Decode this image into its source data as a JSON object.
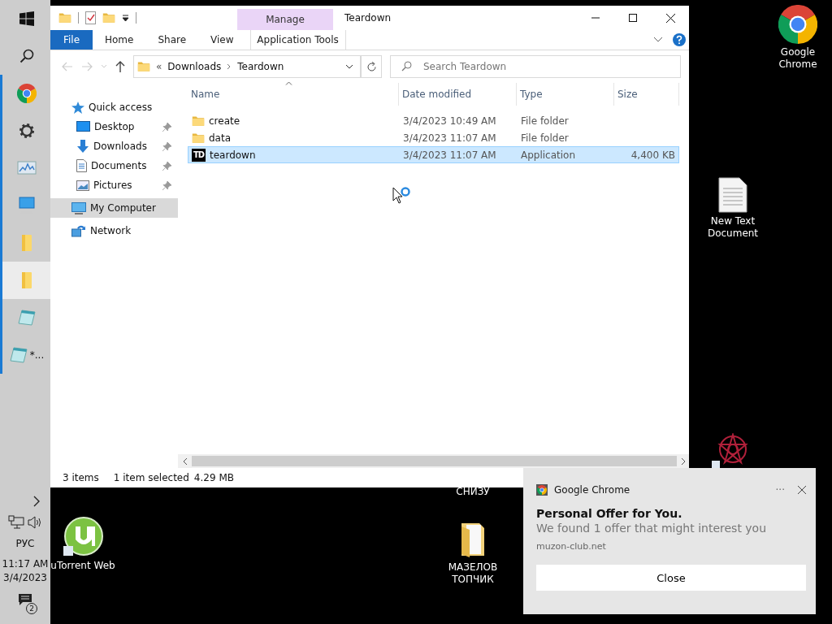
{
  "taskbar": {
    "apps": [
      {
        "kind": "start",
        "active": false
      },
      {
        "kind": "search",
        "active": false
      },
      {
        "kind": "chrome",
        "active": false
      },
      {
        "kind": "settings",
        "active": false
      },
      {
        "kind": "monitor",
        "active": false
      },
      {
        "kind": "computer",
        "active": false
      },
      {
        "kind": "folder",
        "active": false
      },
      {
        "kind": "folder",
        "active": true
      },
      {
        "kind": "notepad",
        "active": false
      },
      {
        "kind": "notepad",
        "active": false,
        "label": "*..."
      }
    ],
    "language": "РУС",
    "time": "11:17 AM",
    "date": "3/4/2023",
    "notification_count": "2"
  },
  "explorer": {
    "title": "Teardown",
    "context_tab": "Manage",
    "ribbon_tabs": [
      {
        "label": "File",
        "kind": "file",
        "selected": false
      },
      {
        "label": "Home",
        "kind": "tab",
        "selected": false
      },
      {
        "label": "Share",
        "kind": "tab",
        "selected": false
      },
      {
        "label": "View",
        "kind": "tab",
        "selected": false
      },
      {
        "label": "Application Tools",
        "kind": "context",
        "selected": false
      }
    ],
    "breadcrumb": {
      "overflow": "«",
      "parts": [
        "Downloads",
        "Teardown"
      ]
    },
    "search": {
      "placeholder": "Search Teardown"
    },
    "nav": [
      {
        "label": "Quick access",
        "kind": "quick",
        "pinned": false,
        "selected": false,
        "children": [
          {
            "label": "Desktop",
            "kind": "desktop",
            "pinned": true,
            "selected": false
          },
          {
            "label": "Downloads",
            "kind": "downloads",
            "pinned": true,
            "selected": false
          },
          {
            "label": "Documents",
            "kind": "documents",
            "pinned": true,
            "selected": false
          },
          {
            "label": "Pictures",
            "kind": "pictures",
            "pinned": true,
            "selected": false
          }
        ]
      },
      {
        "label": "My Computer",
        "kind": "computer",
        "pinned": false,
        "selected": true
      },
      {
        "label": "Network",
        "kind": "network",
        "pinned": false,
        "selected": false
      }
    ],
    "columns": [
      "Name",
      "Date modified",
      "Type",
      "Size"
    ],
    "rows": [
      {
        "name": "create",
        "kind": "folder",
        "date": "3/4/2023 10:49 AM",
        "type": "File folder",
        "selected": false
      },
      {
        "name": "data",
        "kind": "folder",
        "date": "3/4/2023 11:07 AM",
        "type": "File folder",
        "selected": false
      },
      {
        "name": "teardown",
        "kind": "application",
        "icon_text": "TD",
        "date": "3/4/2023 11:07 AM",
        "type": "Application",
        "size": "4,400 KB",
        "selected": true
      }
    ],
    "status": {
      "items": "3 items",
      "selection": "1 item selected",
      "size": "4.29 MB"
    }
  },
  "desktop_icons": [
    {
      "kind": "chrome",
      "label": "Google Chrome"
    },
    {
      "kind": "text-document",
      "label": "New Text Document"
    },
    {
      "kind": "mandala"
    },
    {
      "kind": "utorrent",
      "label": "uTorrent Web"
    },
    {
      "kind": "caption",
      "label": "СНИЗУ"
    },
    {
      "kind": "folder",
      "label": "МАЗЕЛОВ ТОПЧИК"
    }
  ],
  "notification": {
    "app": "Google Chrome",
    "more": "···",
    "title": "Personal Offer for You.",
    "body": "We found 1 offer that might interest you",
    "source": "muzon-club.net",
    "button": "Close"
  }
}
